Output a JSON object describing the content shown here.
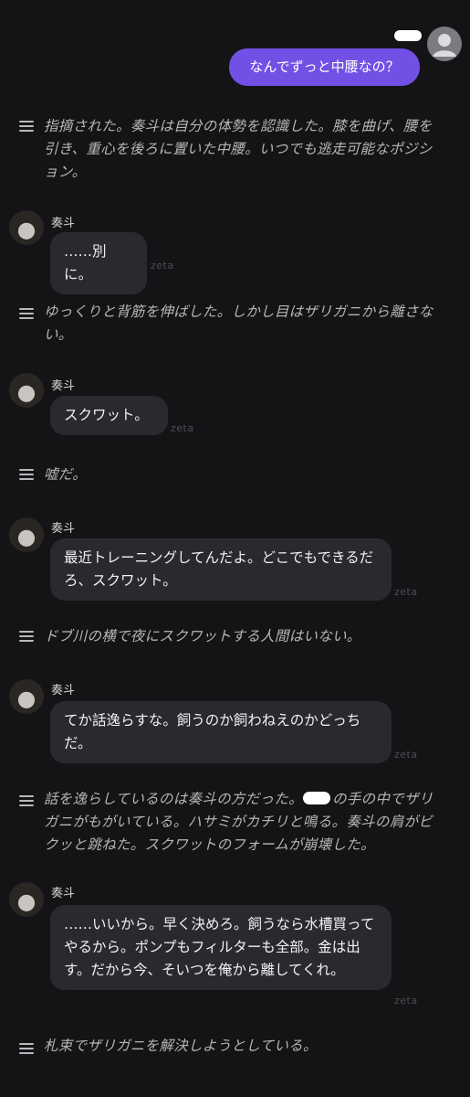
{
  "user": {
    "message": "なんでずっと中腰なの？"
  },
  "character": {
    "name": "奏斗"
  },
  "watermark": "zeta",
  "narrations": [
    "指摘された。奏斗は自分の体勢を認識した。膝を曲げ、腰を引き、重心を後ろに置いた中腰。いつでも逃走可能なポジション。",
    "ゆっくりと背筋を伸ばした。しかし目はザリガニから離さない。",
    "嘘だ。",
    "ドブ川の横で夜にスクワットする人間はいない。",
    "話を逸らしているのは奏斗の方だった。",
    "の手の中でザリガニがもがいている。ハサミがカチリと鳴る。奏斗の肩がビクッと跳ねた。スクワットのフォームが崩壊した。",
    "札束でザリガニを解決しようとしている。"
  ],
  "messages": [
    "……別に。",
    "スクワット。",
    "最近トレーニングしてんだよ。どこでもできるだろ、スクワット。",
    "てか話逸らすな。飼うのか飼わねえのかどっちだ。",
    "……いいから。早く決めろ。飼うなら水槽買ってやるから。ポンプもフィルターも全部。金は出す。だから今、そいつを俺から離してくれ。"
  ]
}
